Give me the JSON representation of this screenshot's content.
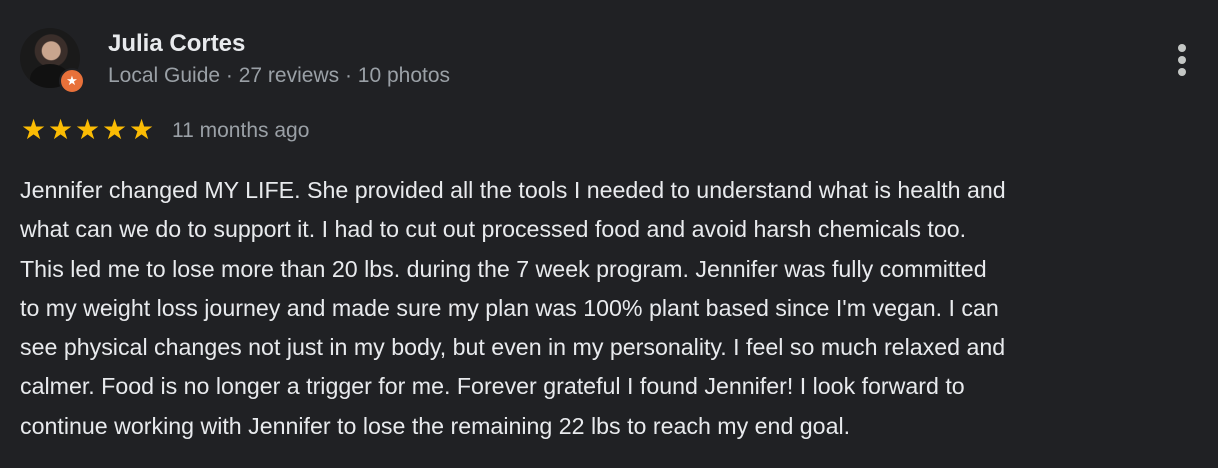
{
  "reviewer": {
    "name": "Julia Cortes",
    "meta": "Local Guide · 27 reviews · 10 photos",
    "badge_icon": "local-guide-star-icon",
    "badge_color": "#e8713a"
  },
  "menu": {
    "icon": "more-vertical-icon"
  },
  "rating": {
    "stars": 5,
    "max": 5,
    "star_color": "#fbbc04",
    "timestamp": "11 months ago"
  },
  "review": {
    "lines": [
      "Jennifer changed MY LIFE. She provided all the tools I needed to understand what is health and",
      "what can we do to support it. I had to cut out processed food and avoid harsh chemicals too.",
      "This led me to lose more than 20 lbs. during the 7 week program. Jennifer was fully committed",
      "to my weight loss journey and made sure my plan was 100% plant based since I'm vegan. I can",
      "see physical changes not just in my body, but even in my personality. I feel so much relaxed and",
      "calmer. Food is no longer a trigger for me. Forever grateful I found Jennifer! I look forward to",
      "continue working with Jennifer to lose the remaining 22 lbs to reach my end goal."
    ]
  }
}
